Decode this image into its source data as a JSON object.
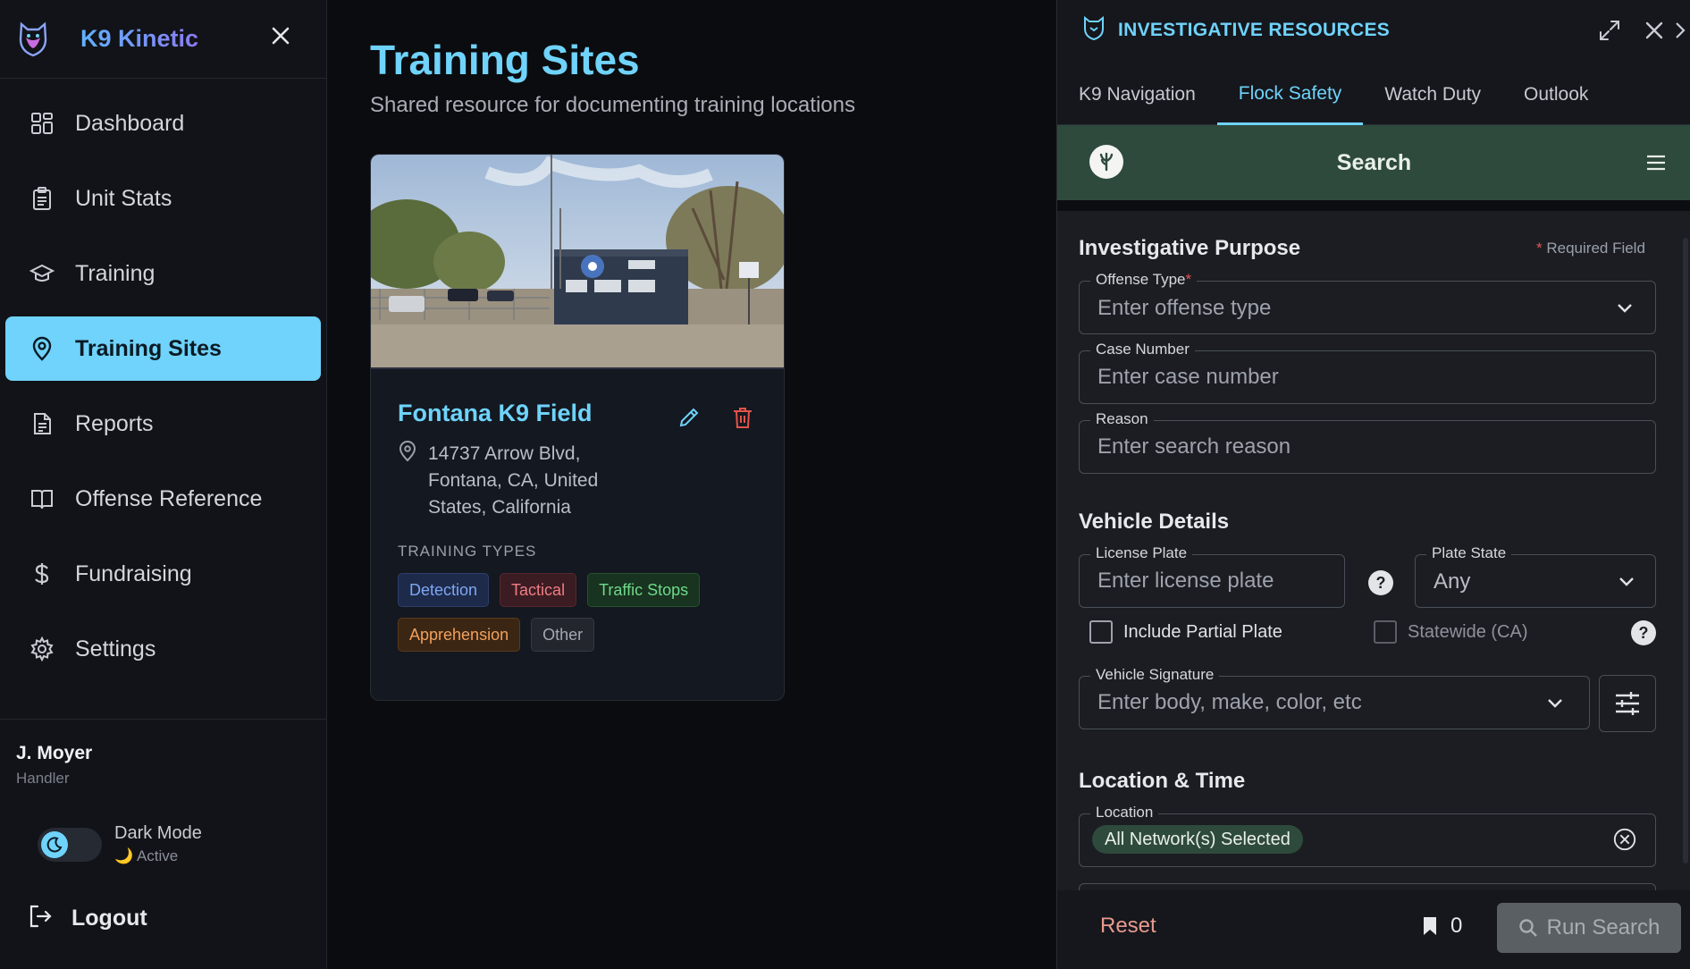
{
  "app": {
    "name": "K9 Kinetic",
    "logo_icon": "k9-shield-logo",
    "accent": "#6fd3fb"
  },
  "sidebar": {
    "items": [
      {
        "label": "Dashboard",
        "icon": "dashboard-icon",
        "active": false
      },
      {
        "label": "Unit Stats",
        "icon": "clipboard-icon",
        "active": false
      },
      {
        "label": "Training",
        "icon": "graduation-cap-icon",
        "active": false
      },
      {
        "label": "Training Sites",
        "icon": "map-pin-icon",
        "active": true
      },
      {
        "label": "Reports",
        "icon": "document-icon",
        "active": false
      },
      {
        "label": "Offense Reference",
        "icon": "book-icon",
        "active": false
      },
      {
        "label": "Fundraising",
        "icon": "dollar-icon",
        "active": false
      },
      {
        "label": "Settings",
        "icon": "gear-icon",
        "active": false
      }
    ],
    "user": {
      "name": "J. Moyer",
      "role": "Handler"
    },
    "dark_mode": {
      "label": "Dark Mode",
      "status": "Active",
      "on": true
    },
    "logout_label": "Logout"
  },
  "main": {
    "title": "Training Sites",
    "subtitle": "Shared resource for documenting training locations",
    "card": {
      "title": "Fontana K9 Field",
      "address": "14737 Arrow Blvd, Fontana, CA, United States, California",
      "training_types_label": "TRAINING TYPES",
      "tags": [
        {
          "label": "Detection",
          "color": "blue"
        },
        {
          "label": "Tactical",
          "color": "red"
        },
        {
          "label": "Traffic Stops",
          "color": "green"
        },
        {
          "label": "Apprehension",
          "color": "orange"
        },
        {
          "label": "Other",
          "color": "gray"
        }
      ]
    }
  },
  "panel": {
    "title": "INVESTIGATIVE RESOURCES",
    "tabs": [
      {
        "label": "K9 Navigation",
        "active": false
      },
      {
        "label": "Flock Safety",
        "active": true
      },
      {
        "label": "Watch Duty",
        "active": false
      },
      {
        "label": "Outlook",
        "active": false
      }
    ],
    "flock": {
      "title": "Search",
      "brand_color": "#2e4a3c",
      "required_note": "Required Field",
      "required_mark": "*",
      "sections": {
        "purpose": "Investigative Purpose",
        "vehicle": "Vehicle Details",
        "location_time": "Location & Time"
      },
      "fields": {
        "offense_type": {
          "label": "Offense Type",
          "placeholder": "Enter offense type"
        },
        "case_number": {
          "label": "Case Number",
          "placeholder": "Enter case number"
        },
        "reason": {
          "label": "Reason",
          "placeholder": "Enter search reason"
        },
        "license_plate": {
          "label": "License Plate",
          "placeholder": "Enter license plate"
        },
        "plate_state": {
          "label": "Plate State",
          "value": "Any"
        },
        "vehicle_signature": {
          "label": "Vehicle Signature",
          "placeholder": "Enter body, make, color, etc"
        },
        "location": {
          "label": "Location",
          "chip": "All Network(s) Selected"
        }
      },
      "checkboxes": {
        "partial_plate": {
          "label": "Include Partial Plate",
          "checked": false
        },
        "statewide": {
          "label": "Statewide (CA)",
          "checked": false
        }
      },
      "help_glyph": "?",
      "footer": {
        "reset_label": "Reset",
        "saved_count": "0",
        "run_label": "Run Search"
      }
    }
  }
}
